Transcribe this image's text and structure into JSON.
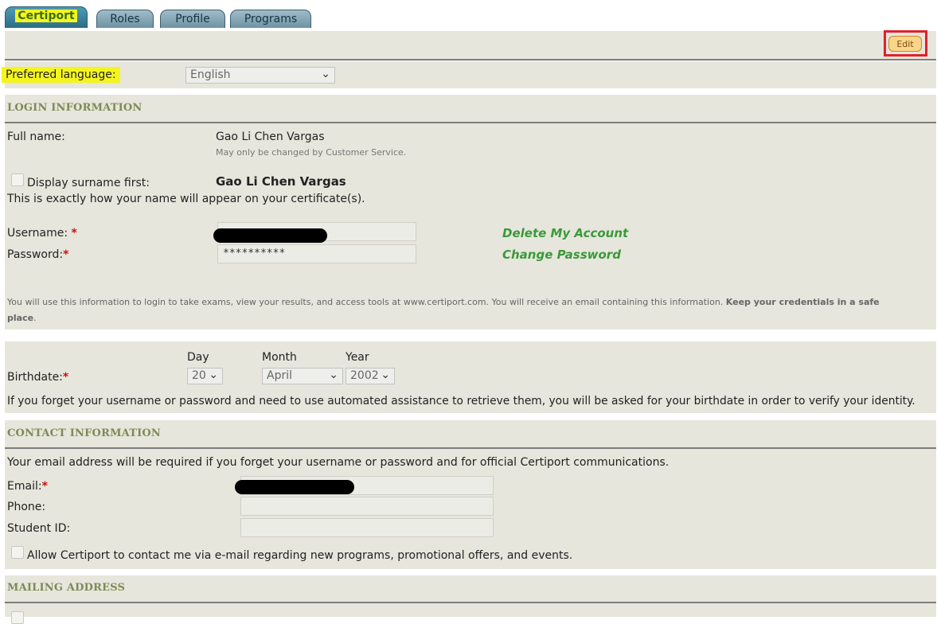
{
  "tabs": [
    "Certiport",
    "Roles",
    "Profile",
    "Programs"
  ],
  "edit_label": "Edit",
  "preferred_language": {
    "label": "Preferred language:",
    "value": "English"
  },
  "login": {
    "title": "LOGIN INFORMATION",
    "full_name_label": "Full name:",
    "full_name_value": "Gao Li Chen Vargas",
    "full_name_note": "May only be changed by Customer Service.",
    "surname_first_label": "Display surname first:",
    "display_name": "Gao Li Chen Vargas",
    "certificate_note": "This is exactly how your name will appear on your certificate(s).",
    "username_label": "Username:",
    "password_label": "Password:",
    "password_value": "**********",
    "delete_account": "Delete My Account",
    "change_password": "Change Password",
    "info_text": "You will use this information to login to take exams, view your results, and access tools at www.certiport.com. You will receive an email containing this information.",
    "info_bold_1": "Keep your credentials in a safe",
    "info_bold_2": "place",
    "info_end": "."
  },
  "birthdate": {
    "day_label": "Day",
    "month_label": "Month",
    "year_label": "Year",
    "label": "Birthdate:",
    "day": "20",
    "month": "April",
    "year": "2002",
    "note": "If you forget your username or password and need to use automated assistance to retrieve them, you will be asked for your birthdate in order to verify your identity."
  },
  "contact": {
    "title": "CONTACT INFORMATION",
    "note": "Your email address will be required if you forget your username or password and for official Certiport communications.",
    "email_label": "Email:",
    "phone_label": "Phone:",
    "student_id_label": "Student ID:",
    "allow_label": "Allow Certiport to contact me via e-mail regarding new programs, promotional offers, and events."
  },
  "mailing": {
    "title": "MAILING ADDRESS"
  },
  "required_mark": "*",
  "chevron": "⌄",
  "colors": {
    "highlight": "#f5f51e",
    "link_green": "#3a9a3a",
    "section_title": "#7e8a55",
    "panel": "#e6e6dc",
    "edit_outline": "#e0212b"
  }
}
